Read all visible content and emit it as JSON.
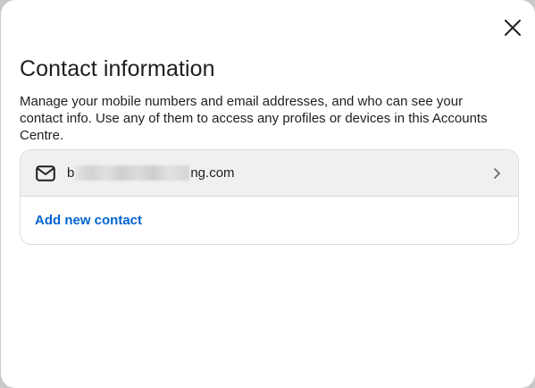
{
  "dialog": {
    "title": "Contact information",
    "description": "Manage your mobile numbers and email addresses, and who can see your contact info. Use any of them to access any profiles or devices in this Accounts Centre.",
    "close_icon": "close-icon"
  },
  "contacts": [
    {
      "icon": "mail-icon",
      "email_prefix": "b",
      "email_suffix": "ng.com",
      "redacted": true,
      "chevron_icon": "chevron-right-icon"
    }
  ],
  "actions": {
    "add_contact_label": "Add new contact"
  },
  "colors": {
    "text": "#1c1e21",
    "link": "#0064d1",
    "row_bg": "#f0f0f0",
    "border": "#dadde1"
  }
}
